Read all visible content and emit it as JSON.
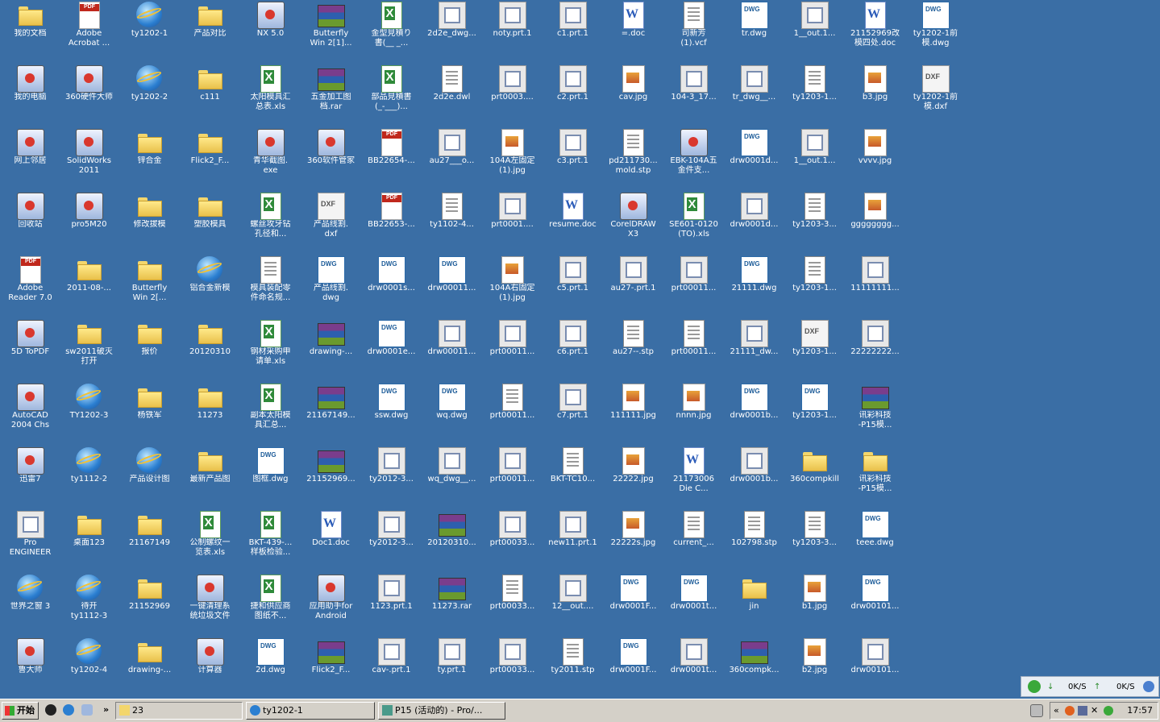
{
  "desktop": {
    "columns": [
      [
        {
          "label": "我的文档",
          "icon": "my-documents-icon",
          "type": "folder"
        },
        {
          "label": "我的电脑",
          "icon": "my-computer-icon",
          "type": "app"
        },
        {
          "label": "网上邻居",
          "icon": "network-places-icon",
          "type": "app"
        },
        {
          "label": "回收站",
          "icon": "recycle-bin-icon",
          "type": "app"
        },
        {
          "label": "Adobe\nReader 7.0",
          "icon": "adobe-reader-icon",
          "type": "pdf"
        },
        {
          "label": "5D ToPDF",
          "icon": "5d-topdf-icon",
          "type": "app"
        },
        {
          "label": "AutoCAD\n2004 Chs",
          "icon": "autocad-icon",
          "type": "app"
        },
        {
          "label": "迅雷7",
          "icon": "xunlei-icon",
          "type": "app"
        },
        {
          "label": "Pro\nENGINEER",
          "icon": "pro-engineer-icon",
          "type": "prt"
        },
        {
          "label": "世界之窗 3",
          "icon": "theworld-browser-icon",
          "type": "ie"
        },
        {
          "label": "鲁大师",
          "icon": "ludashi-icon",
          "type": "app"
        }
      ],
      [
        {
          "label": "Adobe\nAcrobat ...",
          "icon": "adobe-acrobat-icon",
          "type": "pdf"
        },
        {
          "label": "360硬件大师",
          "icon": "360-hardware-icon",
          "type": "app"
        },
        {
          "label": "SolidWorks\n2011",
          "icon": "solidworks-icon",
          "type": "app"
        },
        {
          "label": "pro5M20",
          "icon": "no-entry-icon",
          "type": "app"
        },
        {
          "label": "2011-08-...",
          "icon": "folder-icon",
          "type": "folder"
        },
        {
          "label": "sw2011破灭\n打开",
          "icon": "folder-icon",
          "type": "folder"
        },
        {
          "label": "TY1202-3",
          "icon": "ie-shortcut-icon",
          "type": "ie"
        },
        {
          "label": "ty1112-2",
          "icon": "ie-shortcut-icon",
          "type": "ie"
        },
        {
          "label": "桌面123",
          "icon": "folder-icon",
          "type": "folder"
        },
        {
          "label": "待开\nty1112-3",
          "icon": "ie-shortcut-icon",
          "type": "ie"
        },
        {
          "label": "ty1202-4",
          "icon": "ie-shortcut-icon",
          "type": "ie"
        }
      ],
      [
        {
          "label": "ty1202-1",
          "icon": "ie-shortcut-icon",
          "type": "ie"
        },
        {
          "label": "ty1202-2",
          "icon": "ie-shortcut-icon",
          "type": "ie"
        },
        {
          "label": "锌合金",
          "icon": "folder-icon",
          "type": "folder"
        },
        {
          "label": "修改拔模",
          "icon": "folder-icon",
          "type": "folder"
        },
        {
          "label": "Butterfly\nWin 2[...",
          "icon": "folder-icon",
          "type": "folder"
        },
        {
          "label": "报价",
          "icon": "folder-icon",
          "type": "folder"
        },
        {
          "label": "杨铁军",
          "icon": "folder-icon",
          "type": "folder"
        },
        {
          "label": "产品设计图",
          "icon": "ie-shortcut-icon",
          "type": "ie"
        },
        {
          "label": "21167149",
          "icon": "folder-icon",
          "type": "folder"
        },
        {
          "label": "21152969",
          "icon": "folder-icon",
          "type": "folder"
        },
        {
          "label": "drawing-...",
          "icon": "folder-icon",
          "type": "folder"
        }
      ],
      [
        {
          "label": "产品对比",
          "icon": "folder-icon",
          "type": "folder"
        },
        {
          "label": "c111",
          "icon": "folder-icon",
          "type": "folder"
        },
        {
          "label": "Flick2_F...",
          "icon": "folder-icon",
          "type": "folder"
        },
        {
          "label": "塑胶模具",
          "icon": "folder-icon",
          "type": "folder"
        },
        {
          "label": "铝合金新模",
          "icon": "ie-shortcut-icon",
          "type": "ie"
        },
        {
          "label": "20120310",
          "icon": "folder-icon",
          "type": "folder"
        },
        {
          "label": "11273",
          "icon": "folder-icon",
          "type": "folder"
        },
        {
          "label": "最新产品图",
          "icon": "folder-icon",
          "type": "folder"
        },
        {
          "label": "公制螺纹一\n览表.xls",
          "icon": "excel-file-icon",
          "type": "excel"
        },
        {
          "label": "一键清理系\n统垃圾文件",
          "icon": "batch-file-icon",
          "type": "app"
        },
        {
          "label": "计算器",
          "icon": "calculator-icon",
          "type": "app"
        }
      ],
      [
        {
          "label": "NX 5.0",
          "icon": "nx-icon",
          "type": "app"
        },
        {
          "label": "太阳模具汇\n总表.xls",
          "icon": "excel-file-icon",
          "type": "excel"
        },
        {
          "label": "青华截图.\nexe",
          "icon": "screenshot-app-icon",
          "type": "app"
        },
        {
          "label": "螺丝攻牙钻\n孔径和...",
          "icon": "excel-file-icon",
          "type": "excel"
        },
        {
          "label": "模具装配零\n件命名规...",
          "icon": "text-file-icon",
          "type": "doc"
        },
        {
          "label": "钢材采购申\n请单.xls",
          "icon": "excel-file-icon",
          "type": "excel"
        },
        {
          "label": "副本太阳模\n具汇总...",
          "icon": "excel-file-icon",
          "type": "excel"
        },
        {
          "label": "图框.dwg",
          "icon": "dwg-file-icon",
          "type": "dwg"
        },
        {
          "label": "BKT-439-...\n样板检验...",
          "icon": "excel-file-icon",
          "type": "excel"
        },
        {
          "label": "捷和供应商\n图纸不...",
          "icon": "excel-file-icon",
          "type": "excel"
        },
        {
          "label": "2d.dwg",
          "icon": "dwg-file-icon",
          "type": "dwg"
        }
      ],
      [
        {
          "label": "Butterfly\nWin 2[1]...",
          "icon": "rar-archive-icon",
          "type": "rar"
        },
        {
          "label": "五金加工图\n档.rar",
          "icon": "rar-archive-icon",
          "type": "rar"
        },
        {
          "label": "360软件管家",
          "icon": "360-software-icon",
          "type": "app"
        },
        {
          "label": "产品线割.\ndxf",
          "icon": "dxf-file-icon",
          "type": "dxf"
        },
        {
          "label": "产品线割.\ndwg",
          "icon": "dwg-file-icon",
          "type": "dwg"
        },
        {
          "label": "drawing-...",
          "icon": "rar-archive-icon",
          "type": "rar"
        },
        {
          "label": "21167149...",
          "icon": "rar-archive-icon",
          "type": "rar"
        },
        {
          "label": "21152969...",
          "icon": "rar-archive-icon",
          "type": "rar"
        },
        {
          "label": "Doc1.doc",
          "icon": "word-file-icon",
          "type": "word"
        },
        {
          "label": "应用助手for\nAndroid",
          "icon": "android-helper-icon",
          "type": "app"
        },
        {
          "label": "Flick2_F...",
          "icon": "rar-archive-icon",
          "type": "rar"
        }
      ],
      [
        {
          "label": "金型見積り\n書(__ _...",
          "icon": "excel-file-icon",
          "type": "excel"
        },
        {
          "label": "部品見積書\n(_-___)...",
          "icon": "excel-file-icon",
          "type": "excel"
        },
        {
          "label": "BB22654-...",
          "icon": "pdf-file-icon",
          "type": "pdf"
        },
        {
          "label": "BB22653-...",
          "icon": "pdf-file-icon",
          "type": "pdf"
        },
        {
          "label": "drw0001s...",
          "icon": "dwg-file-icon",
          "type": "dwg"
        },
        {
          "label": "drw0001e...",
          "icon": "dwg-file-icon",
          "type": "dwg"
        },
        {
          "label": "ssw.dwg",
          "icon": "dwg-file-icon",
          "type": "dwg"
        },
        {
          "label": "ty2012-3...",
          "icon": "prt-file-icon",
          "type": "prt"
        },
        {
          "label": "ty2012-3...",
          "icon": "prt-file-icon",
          "type": "prt"
        },
        {
          "label": "1123.prt.1",
          "icon": "prt-file-icon",
          "type": "prt"
        },
        {
          "label": "cav-.prt.1",
          "icon": "prt-file-icon",
          "type": "prt"
        }
      ],
      [
        {
          "label": "2d2e_dwg...",
          "icon": "prt-file-icon",
          "type": "prt"
        },
        {
          "label": "2d2e.dwl",
          "icon": "dwl-file-icon",
          "type": "doc"
        },
        {
          "label": "au27___o...",
          "icon": "prt-file-icon",
          "type": "prt"
        },
        {
          "label": "ty1102-4...",
          "icon": "stp-file-icon",
          "type": "doc"
        },
        {
          "label": "drw00011...",
          "icon": "dwg-file-icon",
          "type": "dwg"
        },
        {
          "label": "drw00011...",
          "icon": "prt-file-icon",
          "type": "prt"
        },
        {
          "label": "wq.dwg",
          "icon": "dwg-file-icon",
          "type": "dwg"
        },
        {
          "label": "wq_dwg__...",
          "icon": "prt-file-icon",
          "type": "prt"
        },
        {
          "label": "20120310...",
          "icon": "rar-archive-icon",
          "type": "rar"
        },
        {
          "label": "11273.rar",
          "icon": "rar-archive-icon",
          "type": "rar"
        },
        {
          "label": "ty.prt.1",
          "icon": "prt-file-icon",
          "type": "prt"
        }
      ],
      [
        {
          "label": "noty.prt.1",
          "icon": "prt-file-icon",
          "type": "prt"
        },
        {
          "label": "prt0003....",
          "icon": "prt-file-icon",
          "type": "prt"
        },
        {
          "label": "104A左固定\n(1).jpg",
          "icon": "jpg-file-icon",
          "type": "jpg"
        },
        {
          "label": "prt0001....",
          "icon": "prt-file-icon",
          "type": "prt"
        },
        {
          "label": "104A右固定\n(1).jpg",
          "icon": "jpg-file-icon",
          "type": "jpg"
        },
        {
          "label": "prt00011...",
          "icon": "prt-file-icon",
          "type": "prt"
        },
        {
          "label": "prt00011...",
          "icon": "stp-file-icon",
          "type": "doc"
        },
        {
          "label": "prt00011...",
          "icon": "prt-file-icon",
          "type": "prt"
        },
        {
          "label": "prt00033...",
          "icon": "prt-file-icon",
          "type": "prt"
        },
        {
          "label": "prt00033...",
          "icon": "stp-file-icon",
          "type": "doc"
        },
        {
          "label": "prt00033...",
          "icon": "prt-file-icon",
          "type": "prt"
        }
      ],
      [
        {
          "label": "c1.prt.1",
          "icon": "prt-file-icon",
          "type": "prt"
        },
        {
          "label": "c2.prt.1",
          "icon": "prt-file-icon",
          "type": "prt"
        },
        {
          "label": "c3.prt.1",
          "icon": "prt-file-icon",
          "type": "prt"
        },
        {
          "label": "resume.doc",
          "icon": "word-file-icon",
          "type": "word"
        },
        {
          "label": "c5.prt.1",
          "icon": "prt-file-icon",
          "type": "prt"
        },
        {
          "label": "c6.prt.1",
          "icon": "prt-file-icon",
          "type": "prt"
        },
        {
          "label": "c7.prt.1",
          "icon": "prt-file-icon",
          "type": "prt"
        },
        {
          "label": "BKT-TC10...",
          "icon": "stp-file-icon",
          "type": "doc"
        },
        {
          "label": "new11.prt.1",
          "icon": "prt-file-icon",
          "type": "prt"
        },
        {
          "label": "12__out....",
          "icon": "prt-file-icon",
          "type": "prt"
        },
        {
          "label": "ty2011.stp",
          "icon": "stp-file-icon",
          "type": "doc"
        }
      ],
      [
        {
          "label": "=.doc",
          "icon": "word-file-icon",
          "type": "word"
        },
        {
          "label": "cav.jpg",
          "icon": "jpg-file-icon",
          "type": "jpg"
        },
        {
          "label": "pd211730...\nmold.stp",
          "icon": "stp-file-icon",
          "type": "doc"
        },
        {
          "label": "CorelDRAW\nX3",
          "icon": "coreldraw-icon",
          "type": "app"
        },
        {
          "label": "au27-.prt.1",
          "icon": "prt-file-icon",
          "type": "prt"
        },
        {
          "label": "au27--.stp",
          "icon": "stp-file-icon",
          "type": "doc"
        },
        {
          "label": "111111.jpg",
          "icon": "jpg-file-icon",
          "type": "jpg"
        },
        {
          "label": "22222.jpg",
          "icon": "jpg-file-icon",
          "type": "jpg"
        },
        {
          "label": "22222s.jpg",
          "icon": "jpg-file-icon",
          "type": "jpg"
        },
        {
          "label": "drw0001F...",
          "icon": "dwg-file-icon",
          "type": "dwg"
        },
        {
          "label": "drw0001F...",
          "icon": "dwg-file-icon",
          "type": "dwg"
        }
      ],
      [
        {
          "label": "司新芳\n(1).vcf",
          "icon": "vcf-file-icon",
          "type": "doc"
        },
        {
          "label": "104-3_17...",
          "icon": "prt-file-icon",
          "type": "prt"
        },
        {
          "label": "EBK-104A五\n金件支...",
          "icon": "paint-file-icon",
          "type": "app"
        },
        {
          "label": "SE601-0120\n(TO).xls",
          "icon": "excel-file-icon",
          "type": "excel"
        },
        {
          "label": "prt00011...",
          "icon": "prt-file-icon",
          "type": "prt"
        },
        {
          "label": "prt00011...",
          "icon": "stp-file-icon",
          "type": "doc"
        },
        {
          "label": "nnnn.jpg",
          "icon": "jpg-file-icon",
          "type": "jpg"
        },
        {
          "label": "21173006\nDie C...",
          "icon": "word-file-icon",
          "type": "word"
        },
        {
          "label": "current_...",
          "icon": "generic-file-icon",
          "type": "doc"
        },
        {
          "label": "drw0001t...",
          "icon": "dwg-file-icon",
          "type": "dwg"
        },
        {
          "label": "drw0001t...",
          "icon": "prt-file-icon",
          "type": "prt"
        }
      ],
      [
        {
          "label": "tr.dwg",
          "icon": "dwg-file-icon",
          "type": "dwg"
        },
        {
          "label": "tr_dwg__...",
          "icon": "prt-file-icon",
          "type": "prt"
        },
        {
          "label": "drw0001d...",
          "icon": "dwg-file-icon",
          "type": "dwg"
        },
        {
          "label": "drw0001d...",
          "icon": "prt-file-icon",
          "type": "prt"
        },
        {
          "label": "21111.dwg",
          "icon": "dwg-file-icon",
          "type": "dwg"
        },
        {
          "label": "21111_dw...",
          "icon": "prt-file-icon",
          "type": "prt"
        },
        {
          "label": "drw0001b...",
          "icon": "dwg-file-icon",
          "type": "dwg"
        },
        {
          "label": "drw0001b...",
          "icon": "prt-file-icon",
          "type": "prt"
        },
        {
          "label": "102798.stp",
          "icon": "stp-file-icon",
          "type": "doc"
        },
        {
          "label": "jin",
          "icon": "folder-icon",
          "type": "folder"
        },
        {
          "label": "360compk...",
          "icon": "rar-archive-icon",
          "type": "rar"
        }
      ],
      [
        {
          "label": "1__out.1...",
          "icon": "prt-file-icon",
          "type": "prt"
        },
        {
          "label": "ty1203-1...",
          "icon": "stp-file-icon",
          "type": "doc"
        },
        {
          "label": "1__out.1...",
          "icon": "prt-file-icon",
          "type": "prt"
        },
        {
          "label": "ty1203-3...",
          "icon": "stp-file-icon",
          "type": "doc"
        },
        {
          "label": "ty1203-1...",
          "icon": "stp-file-icon",
          "type": "doc"
        },
        {
          "label": "ty1203-1...",
          "icon": "dxf-file-icon",
          "type": "dxf"
        },
        {
          "label": "ty1203-1...",
          "icon": "dwg-file-icon",
          "type": "dwg"
        },
        {
          "label": "360compkill",
          "icon": "folder-icon",
          "type": "folder"
        },
        {
          "label": "ty1203-3...",
          "icon": "stp-file-icon",
          "type": "doc"
        },
        {
          "label": "b1.jpg",
          "icon": "jpg-file-icon",
          "type": "jpg"
        },
        {
          "label": "b2.jpg",
          "icon": "jpg-file-icon",
          "type": "jpg"
        }
      ],
      [
        {
          "label": "21152969改\n模四处.doc",
          "icon": "word-file-icon",
          "type": "word"
        },
        {
          "label": "b3.jpg",
          "icon": "jpg-file-icon",
          "type": "jpg"
        },
        {
          "label": "vvvv.jpg",
          "icon": "jpg-file-icon",
          "type": "jpg"
        },
        {
          "label": "gggggggg...",
          "icon": "jpg-file-icon",
          "type": "jpg"
        },
        {
          "label": "11111111...",
          "icon": "prt-file-icon",
          "type": "prt"
        },
        {
          "label": "22222222...",
          "icon": "prt-file-icon",
          "type": "prt"
        },
        {
          "label": "讯彩科技\n-P15模...",
          "icon": "rar-archive-icon",
          "type": "rar"
        },
        {
          "label": "讯彩科技\n-P15模...",
          "icon": "folder-icon",
          "type": "folder"
        },
        {
          "label": "teee.dwg",
          "icon": "dwg-file-icon",
          "type": "dwg"
        },
        {
          "label": "drw00101...",
          "icon": "dwg-file-icon",
          "type": "dwg"
        },
        {
          "label": "drw00101...",
          "icon": "prt-file-icon",
          "type": "prt"
        }
      ],
      [
        {
          "label": "ty1202-1前\n模.dwg",
          "icon": "dwg-file-icon",
          "type": "dwg"
        },
        {
          "label": "ty1202-1前\n模.dxf",
          "icon": "dxf-file-icon",
          "type": "dxf"
        }
      ]
    ]
  },
  "speed_widget": {
    "download": "0K/S",
    "upload": "0K/S"
  },
  "taskbar": {
    "start_label": "开始",
    "chevron": "»",
    "tasks": [
      {
        "label": "23",
        "icon": "folder-icon"
      },
      {
        "label": "ty1202-1",
        "icon": "ie-icon"
      },
      {
        "label": "P15 (活动的) - Pro/...",
        "icon": "pro-engineer-icon"
      }
    ],
    "tray_chevron": "«",
    "clock": "17:57"
  },
  "colors": {
    "desktop": "#3a6ea5",
    "taskbar": "#d4d0c8"
  }
}
